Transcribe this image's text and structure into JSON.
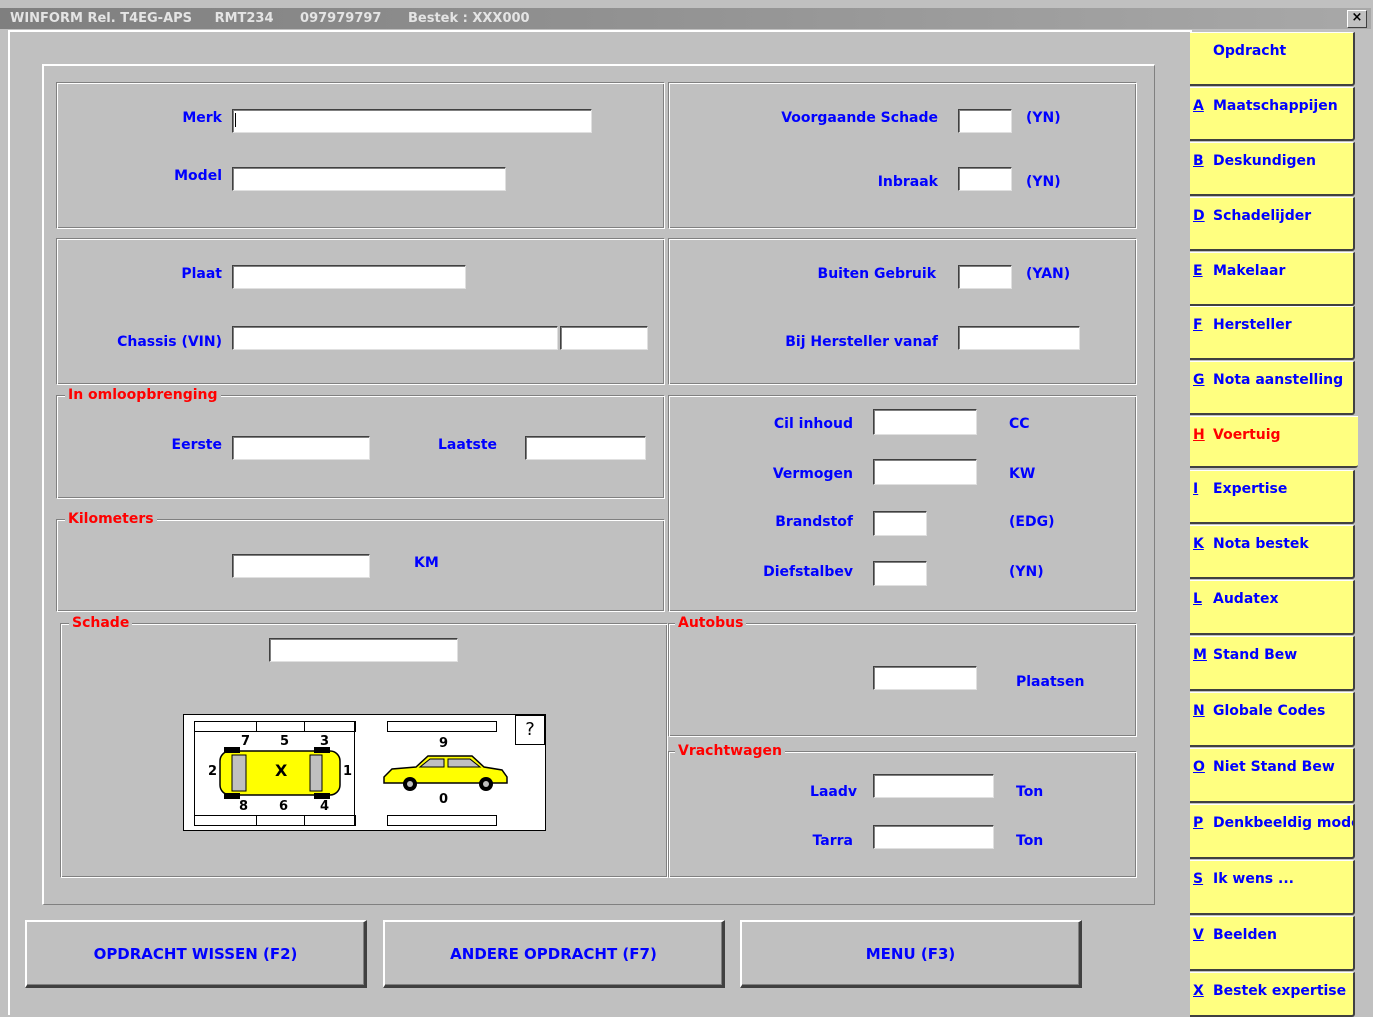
{
  "window": {
    "app": "WINFORM Rel. T4EG-APS",
    "code": "RMT234",
    "number": "097979797",
    "bestek": "Bestek : XXX000",
    "close_glyph": "×"
  },
  "vehicle": {
    "merk_label": "Merk",
    "model_label": "Model",
    "plaat_label": "Plaat",
    "chassis_label": "Chassis (VIN)",
    "voorgaande_label": "Voorgaande Schade",
    "voorgaande_hint": "(YN)",
    "inbraak_label": "Inbraak",
    "inbraak_hint": "(YN)",
    "buiten_label": "Buiten Gebruik",
    "buiten_hint": "(YAN)",
    "hersteller_label": "Bij Hersteller vanaf"
  },
  "omloop": {
    "title": "In omloopbrenging",
    "eerste_label": "Eerste",
    "laatste_label": "Laatste"
  },
  "kilometers": {
    "title": "Kilometers",
    "unit": "KM"
  },
  "specs": {
    "cil_label": "Cil inhoud",
    "cil_unit": "CC",
    "vermogen_label": "Vermogen",
    "vermogen_unit": "KW",
    "brandstof_label": "Brandstof",
    "brandstof_hint": "(EDG)",
    "diefstal_label": "Diefstalbev",
    "diefstal_hint": "(YN)"
  },
  "schade": {
    "title": "Schade",
    "help_glyph": "?",
    "zones": {
      "z1": "1",
      "z2": "2",
      "z3": "3",
      "z4": "4",
      "z5": "5",
      "z6": "6",
      "z7": "7",
      "z8": "8",
      "z9": "9",
      "z0": "0",
      "center": "X"
    }
  },
  "autobus": {
    "title": "Autobus",
    "unit": "Plaatsen"
  },
  "vrachtwagen": {
    "title": "Vrachtwagen",
    "laadv_label": "Laadv",
    "tarra_label": "Tarra",
    "unit": "Ton"
  },
  "buttons": {
    "wissen": "OPDRACHT WISSEN (F2)",
    "andere": "ANDERE OPDRACHT (F7)",
    "menu": "MENU (F3)"
  },
  "tabs": [
    {
      "key": "",
      "label": "Opdracht"
    },
    {
      "key": "A",
      "label": "Maatschappijen"
    },
    {
      "key": "B",
      "label": "Deskundigen"
    },
    {
      "key": "D",
      "label": "Schadelijder"
    },
    {
      "key": "E",
      "label": "Makelaar"
    },
    {
      "key": "F",
      "label": "Hersteller"
    },
    {
      "key": "G",
      "label": "Nota aanstelling"
    },
    {
      "key": "H",
      "label": "Voertuig"
    },
    {
      "key": "I",
      "label": "Expertise"
    },
    {
      "key": "K",
      "label": "Nota bestek"
    },
    {
      "key": "L",
      "label": "Audatex"
    },
    {
      "key": "M",
      "label": "Stand Bew"
    },
    {
      "key": "N",
      "label": "Globale Codes"
    },
    {
      "key": "O",
      "label": "Niet Stand Bew"
    },
    {
      "key": "P",
      "label": "Denkbeeldig model"
    },
    {
      "key": "S",
      "label": "Ik wens ..."
    },
    {
      "key": "V",
      "label": "Beelden"
    },
    {
      "key": "X",
      "label": "Bestek expertise"
    }
  ],
  "active_tab": "Voertuig",
  "colors": {
    "label": "#0000ff",
    "group_title": "#ff0000",
    "tab_bg": "#ffff80",
    "background": "#c0c0c0"
  }
}
